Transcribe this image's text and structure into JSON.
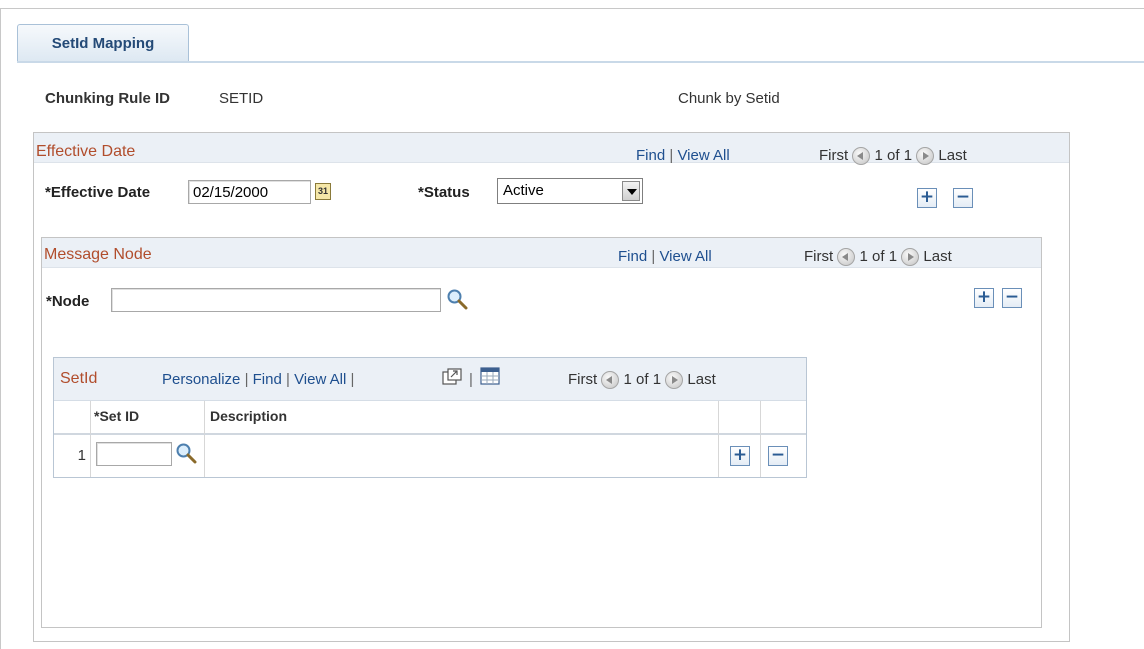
{
  "tab": {
    "label": "SetId Mapping"
  },
  "header": {
    "chunking_rule_label": "Chunking Rule ID",
    "chunking_rule_value": "SETID",
    "description": "Chunk by Setid"
  },
  "effective_date_group": {
    "title": "Effective Date",
    "find": "Find",
    "view_all": "View All",
    "first": "First",
    "count": "1 of 1",
    "last": "Last",
    "effective_date_label": "*Effective Date",
    "effective_date_value": "02/15/2000",
    "status_label": "*Status",
    "status_value": "Active",
    "add": "+",
    "delete": "−"
  },
  "message_node_group": {
    "title": "Message Node",
    "find": "Find",
    "view_all": "View All",
    "first": "First",
    "count": "1 of 1",
    "last": "Last",
    "node_label": "*Node",
    "node_value": "",
    "add": "+",
    "delete": "−"
  },
  "setid_grid": {
    "title": "SetId",
    "personalize": "Personalize",
    "find": "Find",
    "view_all": "View All",
    "first": "First",
    "count": "1 of 1",
    "last": "Last",
    "columns": [
      "*Set ID",
      "Description"
    ],
    "rows": [
      {
        "row_num": "1",
        "set_id": "",
        "description": "",
        "add": "+",
        "delete": "−"
      }
    ]
  },
  "separator": "|",
  "icons": {
    "calendar": "calendar-icon",
    "lookup": "magnifier-icon",
    "zoom": "new-window-icon",
    "download": "spreadsheet-icon",
    "prev": "left-arrow-icon",
    "next": "right-arrow-icon"
  }
}
